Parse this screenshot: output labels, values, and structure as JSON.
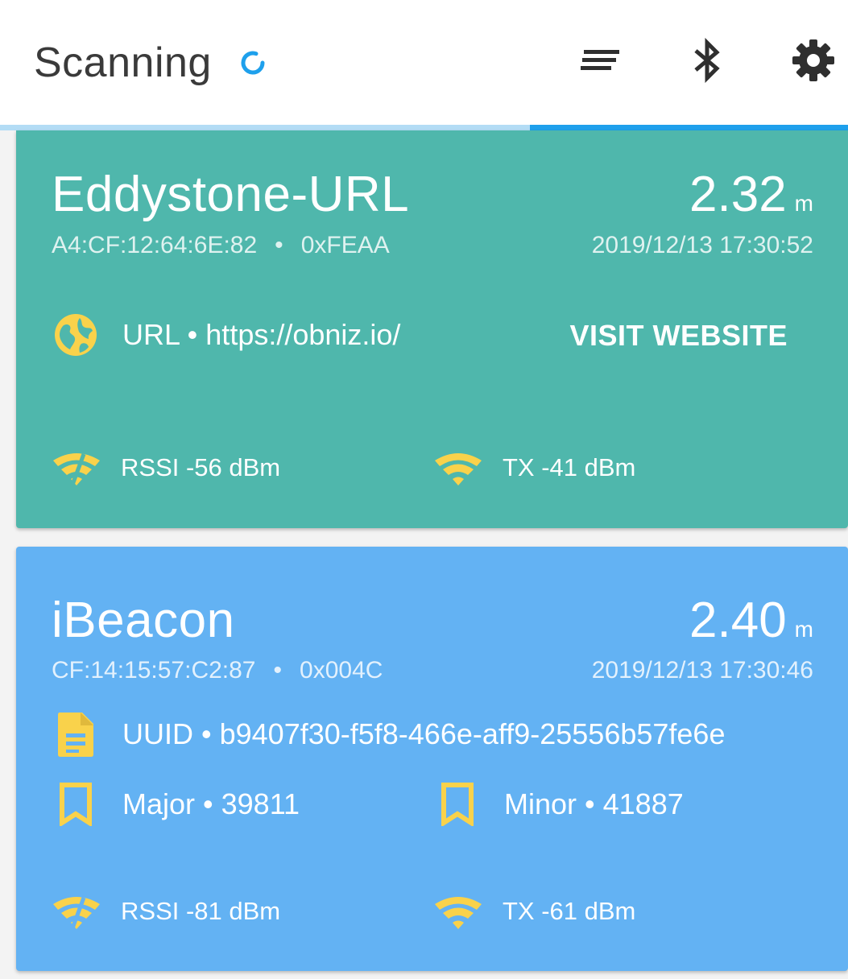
{
  "appbar": {
    "title": "Scanning",
    "icons": [
      "sort-icon",
      "bluetooth-icon",
      "settings-icon"
    ],
    "progress": 0.625
  },
  "colors": {
    "accent": "#1ea0ec",
    "icon_yellow": "#f9d24b",
    "eddystone_card": "#4fb7ac",
    "ibeacon_card": "#63b2f3"
  },
  "cards": [
    {
      "type": "Eddystone-URL",
      "distance": "2.32",
      "unit": "m",
      "address": "A4:CF:12:64:6E:82",
      "service": "0xFEAA",
      "timestamp": "2019/12/13 17:30:52",
      "url_label": "URL • https://obniz.io/",
      "visit_label": "VISIT WEBSITE",
      "rssi": "RSSI -56 dBm",
      "tx": "TX -41 dBm"
    },
    {
      "type": "iBeacon",
      "distance": "2.40",
      "unit": "m",
      "address": "CF:14:15:57:C2:87",
      "service": "0x004C",
      "timestamp": "2019/12/13 17:30:46",
      "uuid_label": "UUID • b9407f30-f5f8-466e-aff9-25556b57fe6e",
      "major_label": "Major • 39811",
      "minor_label": "Minor • 41887",
      "rssi": "RSSI -81 dBm",
      "tx": "TX -61 dBm"
    }
  ]
}
